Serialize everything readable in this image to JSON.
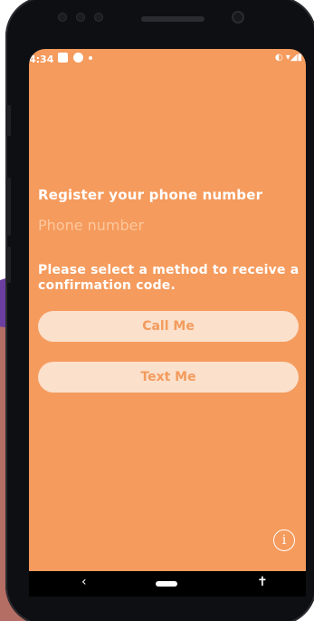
{
  "status_bar": {
    "time": "4:34",
    "right_glyphs": "◐ ▾◢▮"
  },
  "form": {
    "title": "Register your phone number",
    "phone_placeholder": "Phone number",
    "phone_value": "",
    "instruction": "Please select a method to receive a confirmation code.",
    "call_button_label": "Call Me",
    "text_button_label": "Text Me"
  },
  "info": {
    "glyph": "i"
  },
  "nav": {
    "back_glyph": "‹",
    "accessibility_glyph": "✝"
  },
  "colors": {
    "screen_background": "#f59b5d",
    "button_background": "#fbe0cb",
    "button_text": "#f39b5d"
  }
}
